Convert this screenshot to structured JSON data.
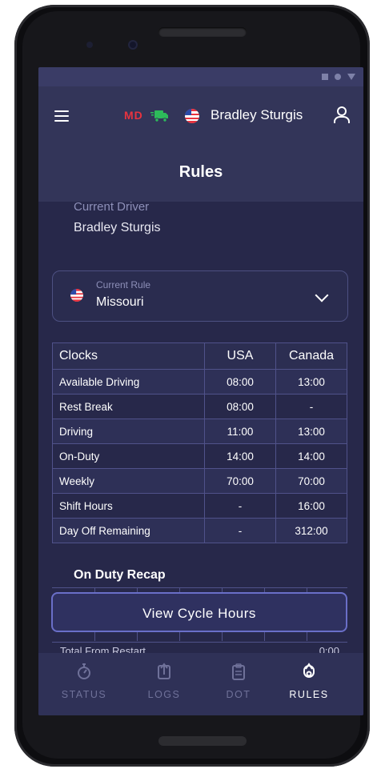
{
  "header": {
    "badge": "MD",
    "driver_name": "Bradley Sturgis",
    "title": "Rules"
  },
  "current_driver": {
    "label": "Current Driver",
    "value": "Bradley Sturgis"
  },
  "current_rule": {
    "label": "Current Rule",
    "value": "Missouri"
  },
  "clocks_table": {
    "headers": [
      "Clocks",
      "USA",
      "Canada"
    ],
    "rows": [
      [
        "Available Driving",
        "08:00",
        "13:00"
      ],
      [
        "Rest Break",
        "08:00",
        "-"
      ],
      [
        "Driving",
        "11:00",
        "13:00"
      ],
      [
        "On-Duty",
        "14:00",
        "14:00"
      ],
      [
        "Weekly",
        "70:00",
        "70:00"
      ],
      [
        "Shift Hours",
        "-",
        "16:00"
      ],
      [
        "Day Off Remaining",
        "-",
        "312:00"
      ]
    ]
  },
  "recap": {
    "title": "On Duty Recap",
    "button_label": "View Cycle Hours",
    "total_label": "Total From Restart",
    "total_value": "0:00"
  },
  "tabs": [
    {
      "label": "STATUS",
      "icon": "stopwatch-icon",
      "active": false
    },
    {
      "label": "LOGS",
      "icon": "upload-document-icon",
      "active": false
    },
    {
      "label": "DOT",
      "icon": "clipboard-icon",
      "active": false
    },
    {
      "label": "RULES",
      "icon": "rules-icon",
      "active": true
    }
  ],
  "colors": {
    "screen_bg": "#27284a",
    "header_bg": "#333559",
    "badge_red": "#e8333f",
    "truck_green": "#2dbb5a",
    "accent_border": "#6a6fc8"
  }
}
